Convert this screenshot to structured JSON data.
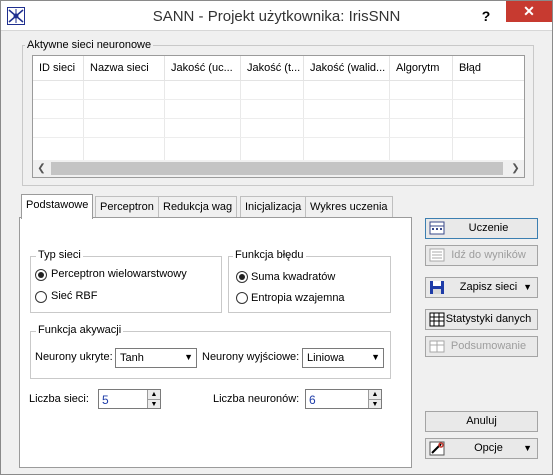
{
  "window": {
    "title": "SANN - Projekt użytkownika: IrisSNN",
    "help_label": "?",
    "close_label": "✕"
  },
  "networks": {
    "group_label": "Aktywne sieci neuronowe",
    "columns": [
      "ID sieci",
      "Nazwa sieci",
      "Jakość (uc...",
      "Jakość (t...",
      "Jakość (walid...",
      "Algorytm",
      "Błąd"
    ],
    "rows": []
  },
  "tabs": [
    {
      "label": "Podstawowe",
      "active": true
    },
    {
      "label": "Perceptron",
      "active": false
    },
    {
      "label": "Redukcja wag",
      "active": false
    },
    {
      "label": "Inicjalizacja",
      "active": false
    },
    {
      "label": "Wykres uczenia",
      "active": false
    }
  ],
  "basic": {
    "network_type": {
      "label": "Typ sieci",
      "options": [
        {
          "label": "Perceptron wielowarstwowy",
          "checked": true
        },
        {
          "label": "Sieć RBF",
          "checked": false
        }
      ]
    },
    "error_function": {
      "label": "Funkcja błędu",
      "options": [
        {
          "label": "Suma kwadratów",
          "checked": true
        },
        {
          "label": "Entropia wzajemna",
          "checked": false
        }
      ]
    },
    "activation": {
      "label": "Funkcja akywacji",
      "hidden_label": "Neurony ukryte:",
      "hidden_value": "Tanh",
      "output_label": "Neurony wyjściowe:",
      "output_value": "Liniowa"
    },
    "network_count": {
      "label": "Liczba sieci:",
      "value": "5"
    },
    "neuron_count": {
      "label": "Liczba neuronów:",
      "value": "6"
    }
  },
  "buttons": {
    "train": "Uczenie",
    "goto_results": "Idź do wyników",
    "save_networks": "Zapisz sieci",
    "data_stats": "Statystyki danych",
    "summary": "Podsumowanie",
    "cancel": "Anuluj",
    "options": "Opcje"
  },
  "colors": {
    "close_button": "#c73a30",
    "spin_value": "#1e3ca8",
    "default_button_border": "#3c7fb1"
  }
}
